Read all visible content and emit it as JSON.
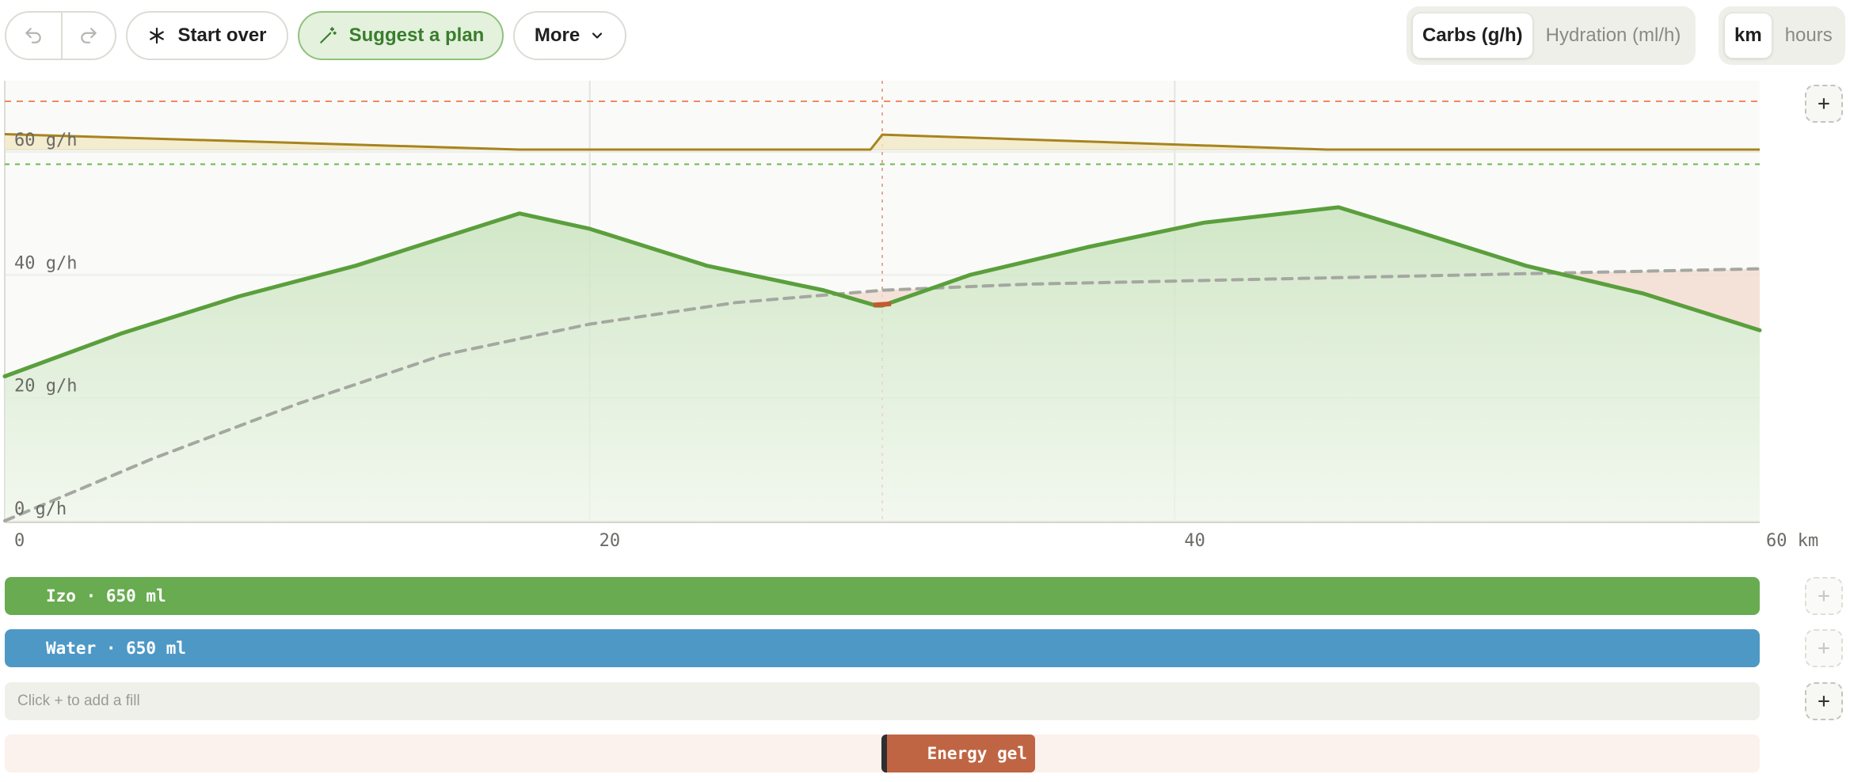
{
  "toolbar": {
    "undo_icon": "undo-icon",
    "redo_icon": "redo-icon",
    "start_over_label": "Start over",
    "start_over_icon": "asterisk-icon",
    "suggest_label": "Suggest a plan",
    "suggest_icon": "magic-wand-icon",
    "more_label": "More",
    "more_icon": "chevron-down-icon",
    "metric_toggle": {
      "options": [
        "Carbs (g/h)",
        "Hydration (ml/h)"
      ],
      "selected": "Carbs (g/h)"
    },
    "unit_toggle": {
      "options": [
        "km",
        "hours"
      ],
      "selected": "km"
    }
  },
  "colors": {
    "accent_green": "#5a9f3c",
    "hydration_gold": "#a8841f",
    "deficit": "#c45a30",
    "target_line": "#f08a60",
    "energy_gel": "#bf6543",
    "water": "#4e98c6",
    "izo": "#68ab50"
  },
  "chart_data": {
    "type": "area",
    "x_unit": "km",
    "xlim": [
      0,
      60
    ],
    "ylim": [
      0,
      60
    ],
    "x_ticks": [
      0,
      20,
      40,
      60
    ],
    "x_tick_labels": [
      "0",
      "20",
      "40",
      "60 km"
    ],
    "y_ticks": [
      0,
      20,
      40,
      60
    ],
    "y_tick_labels": [
      "0 g/h",
      "20 g/h",
      "40 g/h",
      "60 g/h"
    ],
    "grid": true,
    "target_line_y": 58,
    "gel_marker_km": 30,
    "series": [
      {
        "role": "carbs-intake",
        "x": [
          0,
          4,
          8,
          12,
          17.6,
          20,
          24,
          28,
          29.8,
          30,
          33,
          37,
          41,
          45.6,
          48,
          52,
          56,
          60
        ],
        "y": [
          23.5,
          30.5,
          36.5,
          41.5,
          50,
          47.5,
          41.5,
          37.5,
          35,
          35,
          40,
          44.5,
          48.5,
          51,
          47.5,
          41.5,
          37,
          31
        ]
      },
      {
        "role": "carbs-need",
        "x": [
          0,
          2,
          5,
          10,
          15,
          20,
          25,
          30,
          35,
          40,
          45,
          50,
          55,
          60
        ],
        "y": [
          0,
          4,
          10,
          19,
          27,
          32,
          35.5,
          37.5,
          38.5,
          39,
          39.5,
          40,
          40.5,
          41
        ]
      },
      {
        "role": "hydration",
        "x": [
          0,
          17.6,
          29.6,
          30,
          45.2,
          60
        ],
        "y": [
          0.85,
          0,
          0,
          0.82,
          0,
          0
        ]
      }
    ]
  },
  "lanes": {
    "izo_label": "Izo · 650 ml",
    "water_label": "Water · 650 ml",
    "empty_hint": "Click + to add a fill",
    "gel_label": "Energy gel",
    "plus_label": "+"
  }
}
